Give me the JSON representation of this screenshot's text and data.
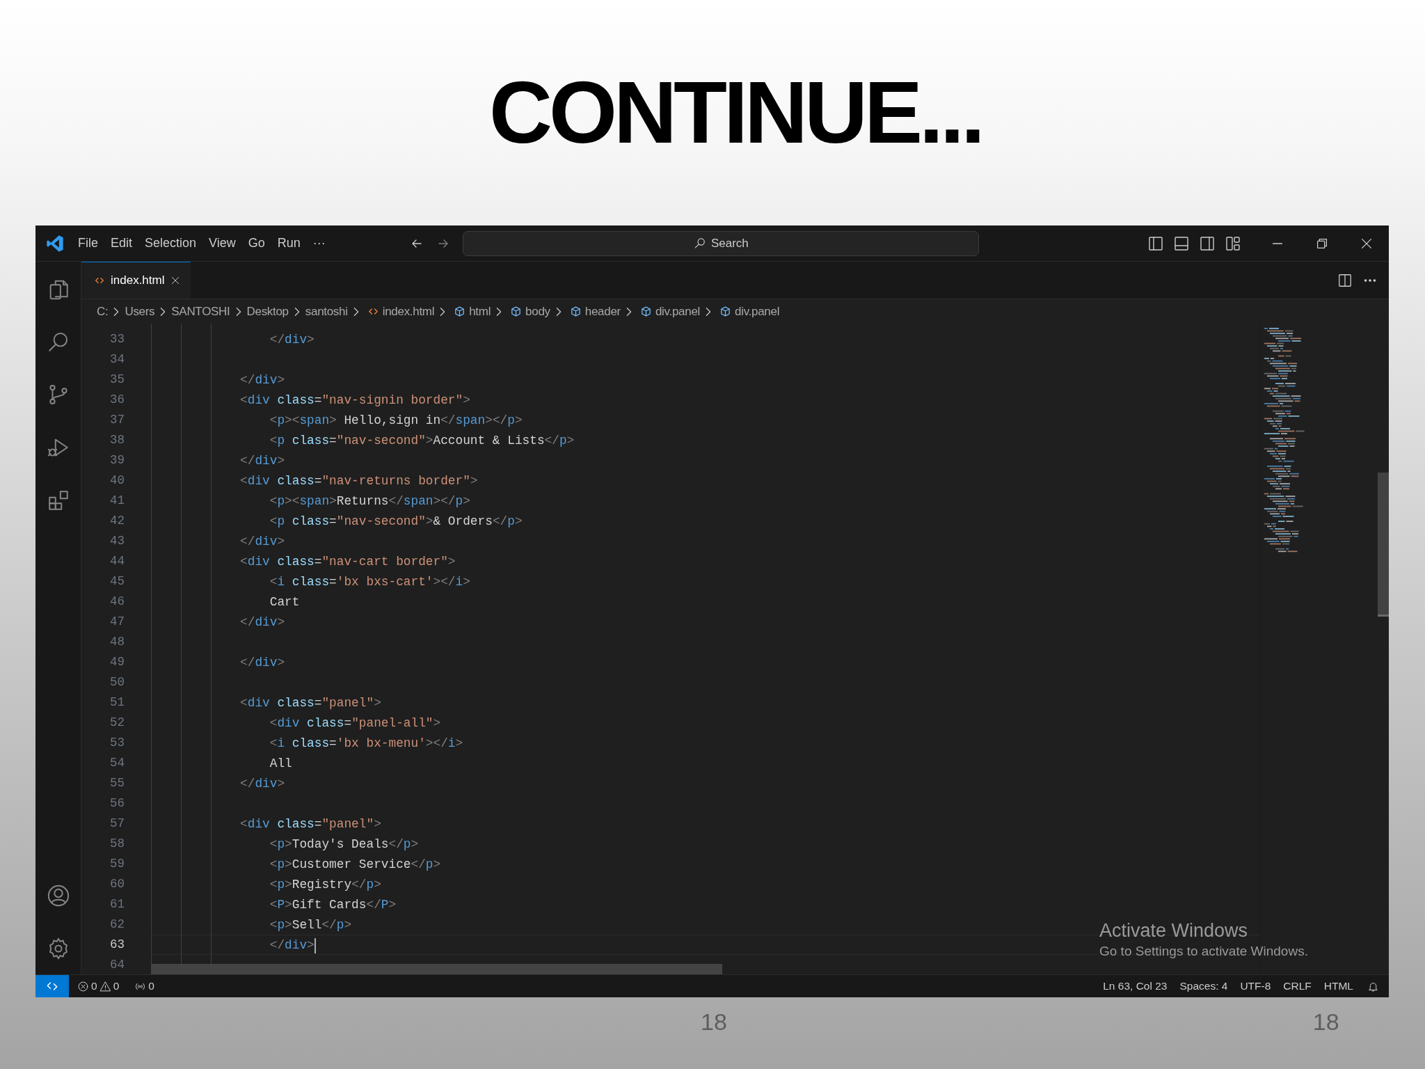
{
  "slide_title": "CONTINUE...",
  "window": {
    "menu": [
      "File",
      "Edit",
      "Selection",
      "View",
      "Go",
      "Run",
      "···"
    ],
    "command_center": {
      "label": "Search"
    },
    "tabs": [
      {
        "label": "index.html",
        "selected": true
      }
    ],
    "breadcrumb": [
      {
        "label": "C:",
        "kind": "folder"
      },
      {
        "label": "Users",
        "kind": "folder"
      },
      {
        "label": "SANTOSHI",
        "kind": "folder"
      },
      {
        "label": "Desktop",
        "kind": "folder"
      },
      {
        "label": "santoshi",
        "kind": "folder"
      },
      {
        "label": "index.html",
        "kind": "file"
      },
      {
        "label": "html",
        "kind": "element"
      },
      {
        "label": "body",
        "kind": "element"
      },
      {
        "label": "header",
        "kind": "element"
      },
      {
        "label": "div.panel",
        "kind": "element"
      },
      {
        "label": "div.panel",
        "kind": "element"
      }
    ],
    "editor": {
      "lines": [
        {
          "number": "33",
          "code": "                </div>",
          "current": false
        },
        {
          "number": "34",
          "current": false
        },
        {
          "number": "35",
          "code": "            </div>",
          "current": false
        },
        {
          "number": "36",
          "code": "            <div class=\"nav-signin border\">",
          "current": false
        },
        {
          "number": "37",
          "code": "                <p><span> Hello,sign in</span></p>",
          "current": false
        },
        {
          "number": "38",
          "code": "                <p class=\"nav-second\">Account & Lists</p>",
          "current": false
        },
        {
          "number": "39",
          "code": "            </div>",
          "current": false
        },
        {
          "number": "40",
          "code": "            <div class=\"nav-returns border\">",
          "current": false
        },
        {
          "number": "41",
          "code": "                <p><span>Returns</span></p>",
          "current": false
        },
        {
          "number": "42",
          "code": "                <p class=\"nav-second\">& Orders</p>",
          "current": false
        },
        {
          "number": "43",
          "code": "            </div>",
          "current": false
        },
        {
          "number": "44",
          "code": "            <div class=\"nav-cart border\">",
          "current": false
        },
        {
          "number": "45",
          "code": "                <i class='bx bxs-cart'></i>",
          "current": false
        },
        {
          "number": "46",
          "code": "                Cart",
          "current": false
        },
        {
          "number": "47",
          "code": "            </div>",
          "current": false
        },
        {
          "number": "48",
          "current": false
        },
        {
          "number": "49",
          "code": "            </div>",
          "current": false
        },
        {
          "number": "50",
          "current": false
        },
        {
          "number": "51",
          "code": "            <div class=\"panel\">",
          "current": false
        },
        {
          "number": "52",
          "code": "                <div class=\"panel-all\">",
          "current": false
        },
        {
          "number": "53",
          "code": "                <i class='bx bx-menu'></i>",
          "current": false
        },
        {
          "number": "54",
          "code": "                All",
          "current": false
        },
        {
          "number": "55",
          "code": "            </div>",
          "current": false
        },
        {
          "number": "56",
          "current": false
        },
        {
          "number": "57",
          "code": "            <div class=\"panel\">",
          "current": false
        },
        {
          "number": "58",
          "code": "                <p>Today's Deals</p>",
          "current": false
        },
        {
          "number": "59",
          "code": "                <p>Customer Service</p>",
          "current": false
        },
        {
          "number": "60",
          "code": "                <p>Registry</p>",
          "current": false
        },
        {
          "number": "61",
          "code": "                <P>Gift Cards</P>",
          "current": false
        },
        {
          "number": "62",
          "code": "                <p>Sell</p>",
          "current": false
        },
        {
          "number": "63",
          "code": "                </div>",
          "current": true
        },
        {
          "number": "64",
          "current": false
        }
      ]
    },
    "activation_notice": {
      "title": "Activate Windows",
      "subtitle": "Go to Settings to activate Windows."
    },
    "status_bar": {
      "errors": "0",
      "warnings": "0",
      "ports": "0",
      "items": [
        "Ln 63, Col 23",
        "Spaces: 4",
        "UTF-8",
        "CRLF",
        "HTML"
      ]
    }
  },
  "page_numbers": [
    "18",
    "18"
  ]
}
